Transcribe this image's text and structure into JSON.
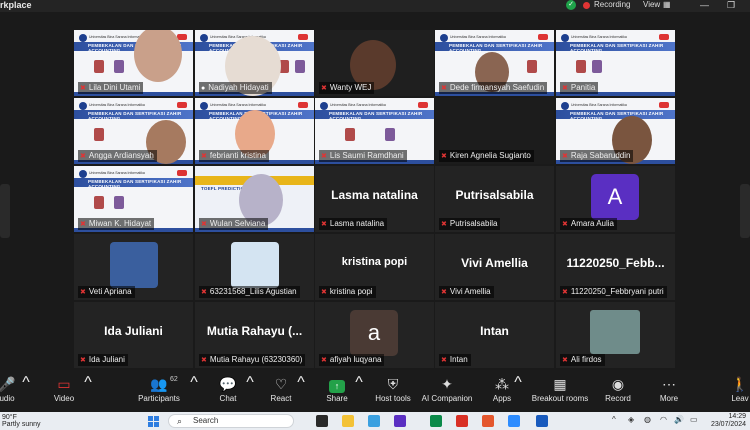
{
  "window": {
    "title": "rkplace",
    "recording_label": "Recording",
    "view_label": "View"
  },
  "grid": {
    "tiles": [
      {
        "name": "Lila Dini Utami"
      },
      {
        "name": "Nadiyah Hidayati"
      },
      {
        "name": "Wanty WEJ"
      },
      {
        "name": "Dede firmansyah Saefudin"
      },
      {
        "name": "Panitia"
      },
      {
        "name": "Angga Ardiansyah"
      },
      {
        "name": "febrianti kristina"
      },
      {
        "name": "Lis Saumi Ramdhani"
      },
      {
        "name": "Kiren Agnelia Sugianto"
      },
      {
        "name": "Raja Sabaruddin"
      },
      {
        "name": "Miwan K. Hidayat"
      },
      {
        "name": "Wulan Selviana"
      },
      {
        "name": "Lasma natalina",
        "display": "Lasma natalina"
      },
      {
        "name": "Putrisalsabila",
        "display": "Putrisalsabila"
      },
      {
        "name": "Amara Aulia",
        "avatar": "A"
      },
      {
        "name": "Veti Apriana"
      },
      {
        "name": "63231568_Lilis Agustian"
      },
      {
        "name": "kristina popi",
        "display": "kristina popi"
      },
      {
        "name": "Vivi Amellia",
        "display": "Vivi Amellia"
      },
      {
        "name": "11220250_Febbryani putri",
        "display": "11220250_Febb..."
      },
      {
        "name": "Ida Juliani",
        "display": "Ida Juliani"
      },
      {
        "name": "Mutia Rahayu (63230360)",
        "display": "Mutia Rahayu (..."
      },
      {
        "name": "afiyah luqyana",
        "avatar": "a"
      },
      {
        "name": "Intan",
        "display": "Intan"
      },
      {
        "name": "Ali firdos"
      }
    ],
    "slide_header": "Universitas Bina Sarana Informatika",
    "slide_band": "PEMBEKALAN DAN SERTIFIKASI ZAHIR ACCOUNTING",
    "slide_alt_band": "TOEFL PREDICTION TEST"
  },
  "toolbar": {
    "audio": "udio",
    "video": "Video",
    "participants": "Participants",
    "participants_count": "62",
    "chat": "Chat",
    "react": "React",
    "share": "Share",
    "host_tools": "Host tools",
    "ai_companion": "AI Companion",
    "apps": "Apps",
    "breakout": "Breakout rooms",
    "record": "Record",
    "more": "More",
    "leave": "Leav"
  },
  "taskbar": {
    "temp": "90°F",
    "weather_text": "Partly sunny",
    "search_placeholder": "Search",
    "time": "14:29",
    "date": "23/07/2024"
  },
  "colors": {
    "highlight": "#28c46a",
    "muted_mic": "#e03434",
    "share_green": "#23a149",
    "avatar_A": "#5a2fc2",
    "avatar_a": "#4a3a34"
  }
}
